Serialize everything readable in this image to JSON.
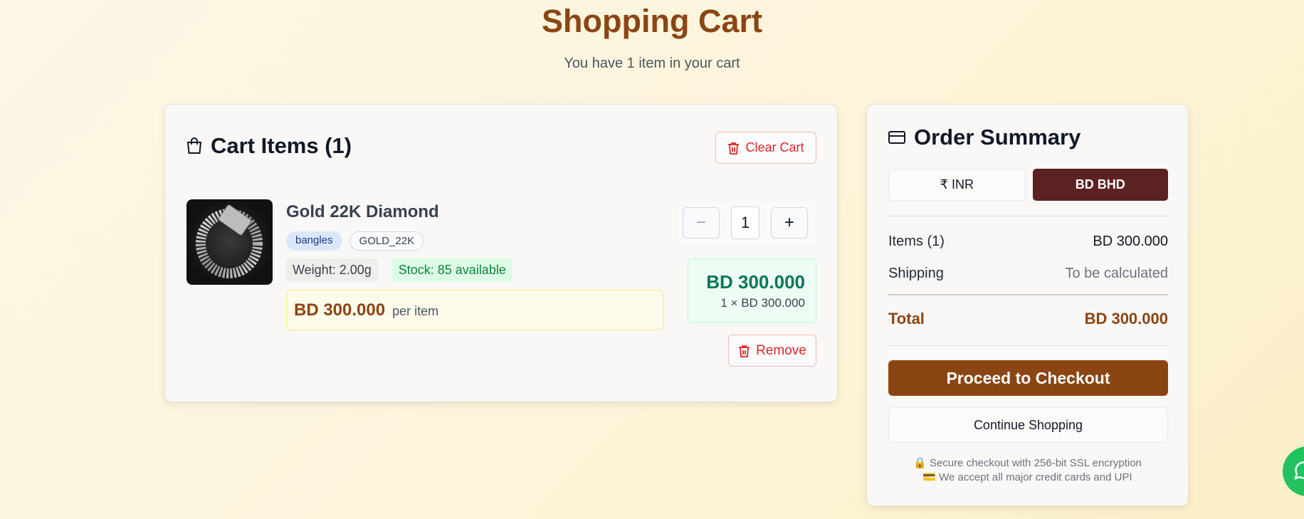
{
  "page": {
    "title": "Shopping Cart",
    "subtitle": "You have 1 item in your cart"
  },
  "cart": {
    "heading": "Cart Items (1)",
    "clear_label": "Clear Cart",
    "item": {
      "name": "Gold 22K Diamond",
      "tags": [
        "bangles",
        "GOLD_22K"
      ],
      "weight": "Weight: 2.00g",
      "stock": "Stock: 85 available",
      "unit_price": "BD 300.000",
      "unit_suffix": "per item",
      "quantity": "1",
      "minus_label": "−",
      "plus_label": "+",
      "line_total": "BD 300.000",
      "line_calc": "1 × BD 300.000",
      "remove_label": "Remove"
    }
  },
  "summary": {
    "heading": "Order Summary",
    "currencies": [
      "₹ INR",
      "BD BHD"
    ],
    "selected_currency": "BD BHD",
    "items_label": "Items (1)",
    "items_value": "BD 300.000",
    "shipping_label": "Shipping",
    "shipping_value": "To be calculated",
    "total_label": "Total",
    "total_value": "BD 300.000",
    "checkout_label": "Proceed to Checkout",
    "continue_label": "Continue Shopping",
    "note_secure": "🔒 Secure checkout with 256-bit SSL encryption",
    "note_cards": "💳 We accept all major credit cards and UPI"
  },
  "colors": {
    "brand": "#8b4513",
    "selected_currency_bg": "#5c2121",
    "danger": "#dc2626",
    "success": "#047857",
    "whatsapp": "#22c35e"
  },
  "icons": {
    "cart_heading": "shopping-bag-icon",
    "clear": "trash-icon",
    "remove": "trash-icon",
    "summary_heading": "credit-card-icon",
    "floating": "whatsapp-icon"
  }
}
